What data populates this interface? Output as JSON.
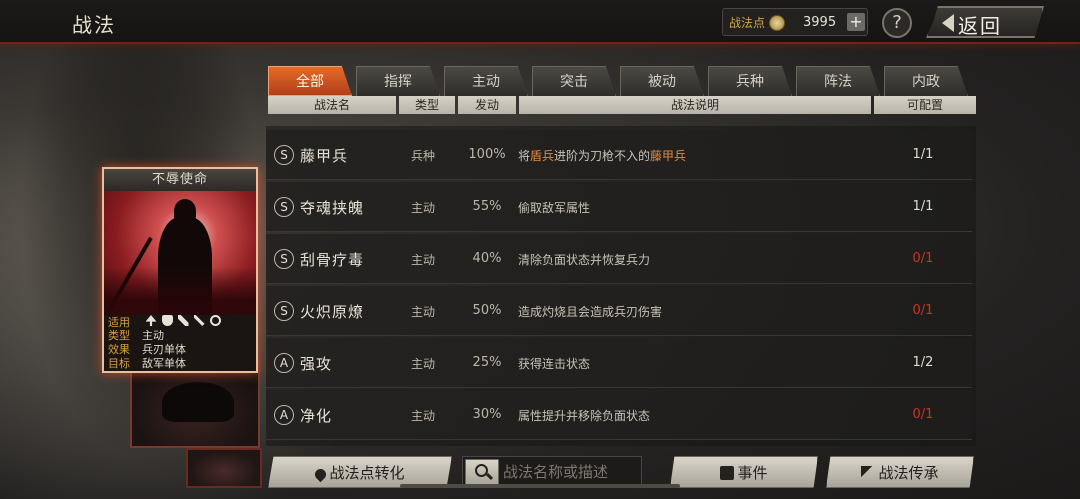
{
  "header": {
    "title": "战法",
    "points_label": "战法点",
    "points_value": "3995",
    "plus": "+",
    "help": "?",
    "back_label": "返回"
  },
  "tabs": [
    {
      "label": "全部",
      "active": true
    },
    {
      "label": "指挥"
    },
    {
      "label": "主动"
    },
    {
      "label": "突击"
    },
    {
      "label": "被动"
    },
    {
      "label": "兵种"
    },
    {
      "label": "阵法"
    },
    {
      "label": "内政"
    }
  ],
  "columns": [
    "战法名",
    "类型",
    "发动",
    "战法说明",
    "可配置"
  ],
  "skills": [
    {
      "grade": "S",
      "name": "藤甲兵",
      "type": "兵种",
      "rate": "100%",
      "desc_parts": [
        "将",
        "盾兵",
        "进阶为刀枪不入的",
        "藤甲兵"
      ],
      "count": "1/1",
      "count_red": false
    },
    {
      "grade": "S",
      "name": "夺魂挟魄",
      "type": "主动",
      "rate": "55%",
      "desc": "偷取敌军属性",
      "count": "1/1",
      "count_red": false
    },
    {
      "grade": "S",
      "name": "刮骨疗毒",
      "type": "主动",
      "rate": "40%",
      "desc": "清除负面状态并恢复兵力",
      "count": "0/1",
      "count_red": true
    },
    {
      "grade": "S",
      "name": "火炽原燎",
      "type": "主动",
      "rate": "50%",
      "desc": "造成灼烧且会造成兵刃伤害",
      "count": "0/1",
      "count_red": true
    },
    {
      "grade": "A",
      "name": "强攻",
      "type": "主动",
      "rate": "25%",
      "desc": "获得连击状态",
      "count": "1/2",
      "count_red": false
    },
    {
      "grade": "A",
      "name": "净化",
      "type": "主动",
      "rate": "30%",
      "desc": "属性提升并移除负面状态",
      "count": "0/1",
      "count_red": true
    }
  ],
  "card": {
    "title": "不辱使命",
    "apply_label": "适用",
    "type_label": "类型",
    "type_value": "主动",
    "effect_label": "效果",
    "effect_value": "兵刃单体",
    "target_label": "目标",
    "target_value": "敌军单体"
  },
  "bottom": {
    "convert_label": "战法点转化",
    "search_placeholder": "战法名称或描述",
    "event_label": "事件",
    "inherit_label": "战法传承"
  },
  "colors": {
    "accent_orange": "#e46a28",
    "highlight": "#e88a3a",
    "count_red": "#c83426",
    "card_glow": "#e65028"
  }
}
